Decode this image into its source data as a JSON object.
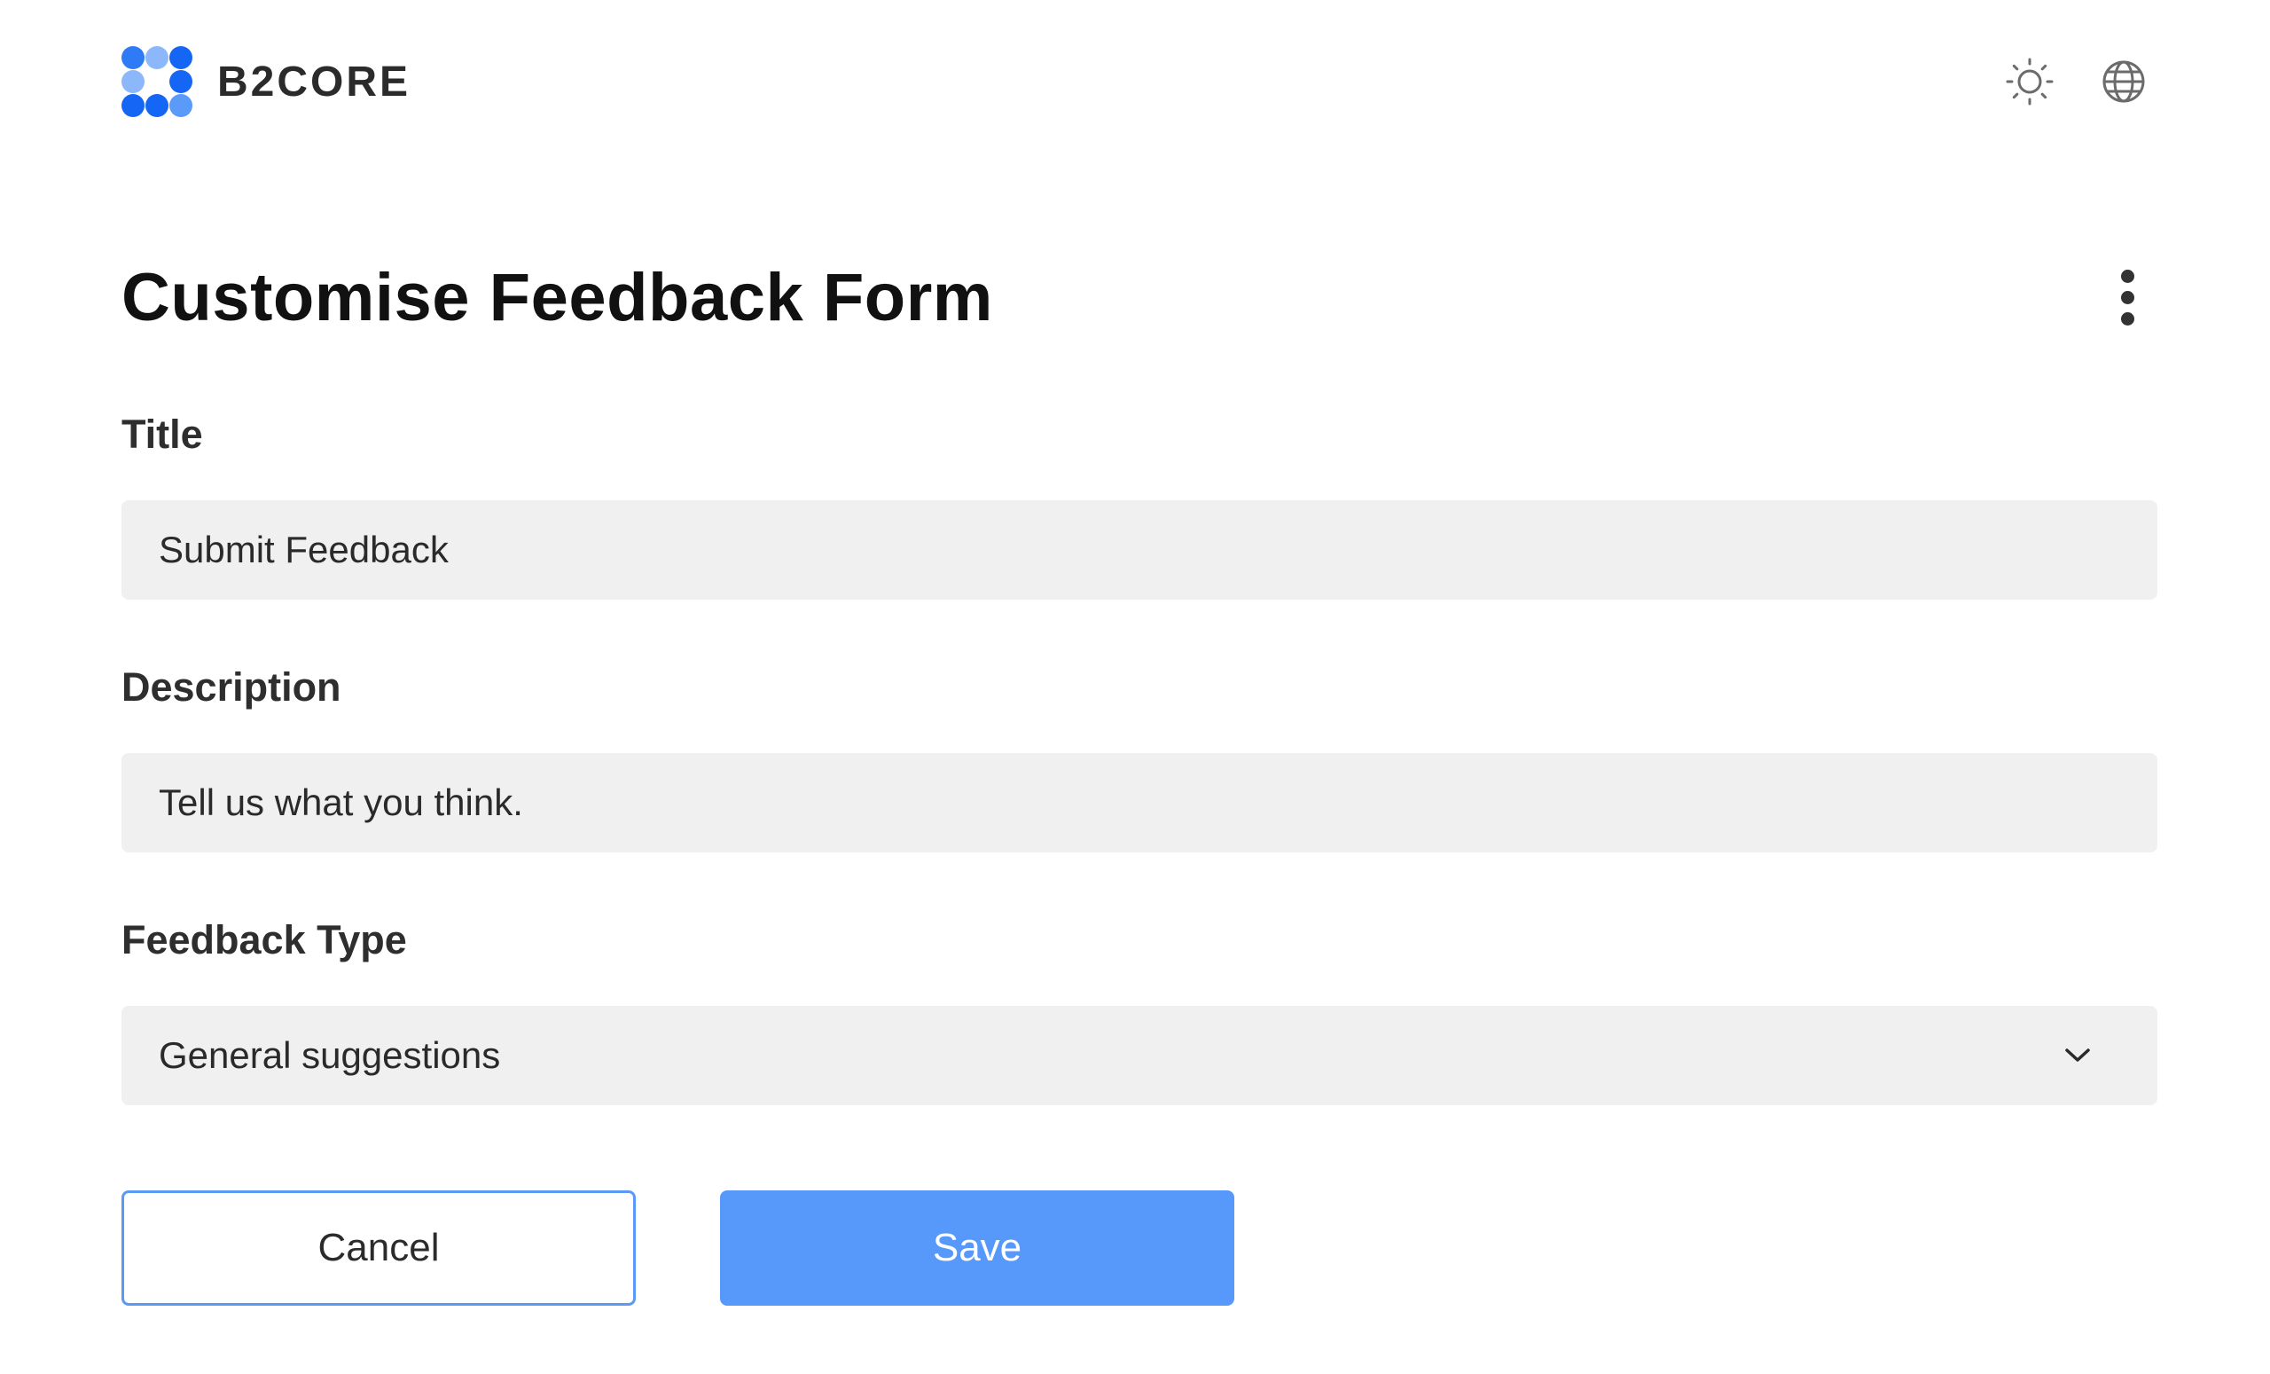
{
  "app": {
    "brand_name": "B2CORE"
  },
  "logo_dots": [
    "#2f7bf5",
    "#8db7fb",
    "#1666f5",
    "#8db7fb",
    "#ffffff",
    "#1666f5",
    "#1666f5",
    "#1666f5",
    "#5a9af8"
  ],
  "topbar": {
    "theme_icon": "sun-icon",
    "language_icon": "globe-icon"
  },
  "page": {
    "title": "Customise Feedback Form",
    "menu_icon": "more-vertical-icon"
  },
  "form": {
    "title_label": "Title",
    "title_value": "Submit Feedback",
    "description_label": "Description",
    "description_value": "Tell us what you think.",
    "feedback_type_label": "Feedback Type",
    "feedback_type_selected": "General suggestions",
    "feedback_type_icon": "chevron-down-icon"
  },
  "actions": {
    "cancel_label": "Cancel",
    "save_label": "Save"
  },
  "colors": {
    "accent": "#5799fa",
    "accent_border": "#5b99f7",
    "field_background": "#f0f0f0"
  }
}
